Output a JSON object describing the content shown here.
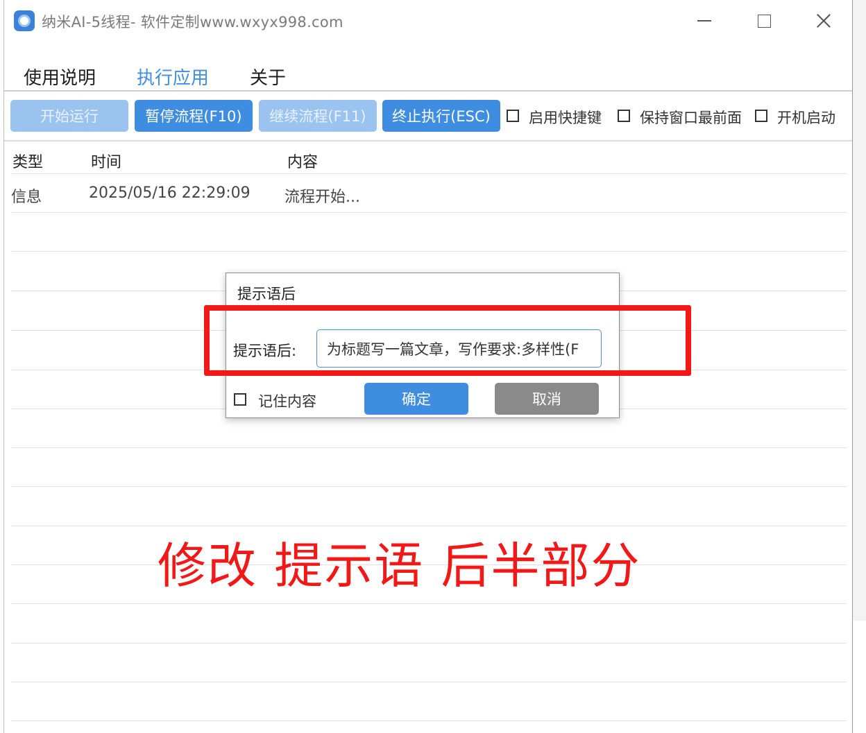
{
  "window": {
    "title": "纳米AI-5线程- 软件定制www.wxyx998.com",
    "controls": {
      "minimize": "minimize-icon",
      "maximize": "maximize-icon",
      "close": "close-icon"
    }
  },
  "menu": {
    "items": [
      {
        "label": "使用说明",
        "active": false
      },
      {
        "label": "执行应用",
        "active": true
      },
      {
        "label": "关于",
        "active": false
      }
    ]
  },
  "toolbar": {
    "start_label": "开始运行",
    "pause_label": "暂停流程(F10)",
    "continue_label": "继续流程(F11)",
    "stop_label": "终止执行(ESC)",
    "options": [
      {
        "label": "启用快捷键",
        "checked": false
      },
      {
        "label": "保持窗口最前面",
        "checked": false
      },
      {
        "label": "开机启动",
        "checked": false
      }
    ]
  },
  "log": {
    "columns": [
      "类型",
      "时间",
      "内容"
    ],
    "rows": [
      {
        "type": "信息",
        "time": "2025/05/16 22:29:09",
        "content": "流程开始..."
      }
    ]
  },
  "dialog": {
    "title": "提示语后",
    "field_label": "提示语后:",
    "field_value": "为标题写一篇文章，写作要求:多样性(F",
    "remember_label": "记住内容",
    "remember_checked": false,
    "ok_label": "确定",
    "cancel_label": "取消"
  },
  "annotation": {
    "text": "修改  提示语  后半部分",
    "color": "#f21818"
  },
  "colors": {
    "accent": "#3e8de0",
    "disabled": "#9ac3f0",
    "cancel": "#8a8a8a"
  }
}
